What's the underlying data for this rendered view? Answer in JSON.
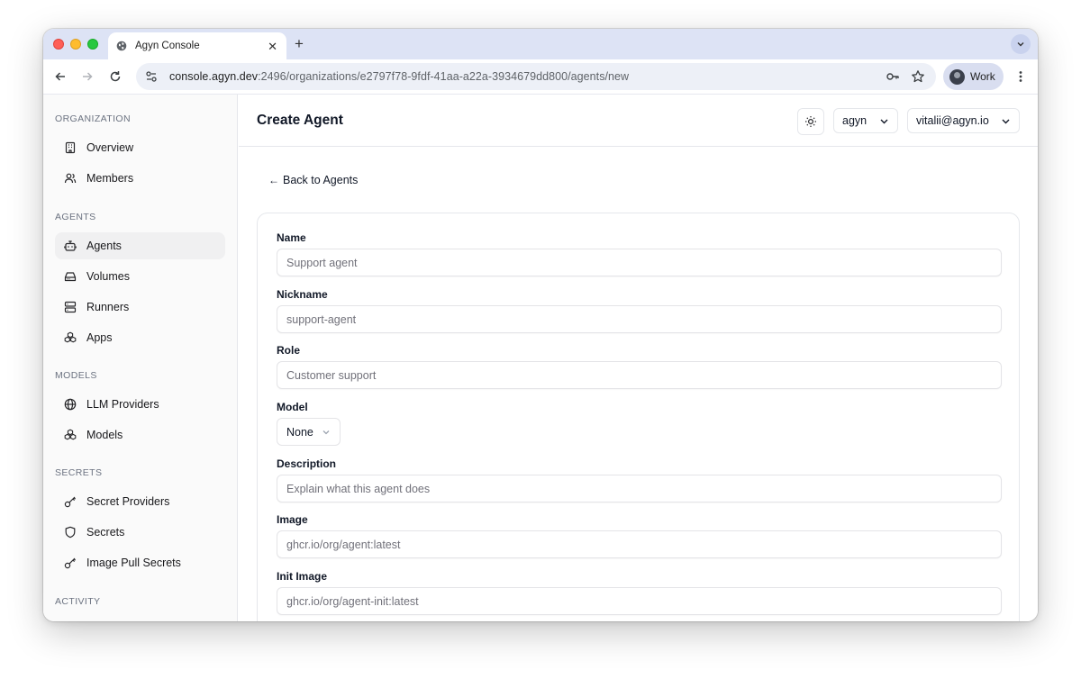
{
  "browser": {
    "tab_title": "Agyn Console",
    "new_tab_glyph": "+",
    "url_host": "console.agyn.dev",
    "url_path": ":2496/organizations/e2797f78-9fdf-41aa-a22a-3934679dd800/agents/new",
    "profile_label": "Work"
  },
  "sidebar": {
    "sections": [
      {
        "label": "ORGANIZATION",
        "items": [
          {
            "label": "Overview",
            "icon": "building-icon"
          },
          {
            "label": "Members",
            "icon": "users-icon"
          }
        ]
      },
      {
        "label": "AGENTS",
        "items": [
          {
            "label": "Agents",
            "icon": "bot-icon",
            "active": true
          },
          {
            "label": "Volumes",
            "icon": "hard-drive-icon"
          },
          {
            "label": "Runners",
            "icon": "server-icon"
          },
          {
            "label": "Apps",
            "icon": "boxes-icon"
          }
        ]
      },
      {
        "label": "MODELS",
        "items": [
          {
            "label": "LLM Providers",
            "icon": "globe-icon"
          },
          {
            "label": "Models",
            "icon": "boxes-icon"
          }
        ]
      },
      {
        "label": "SECRETS",
        "items": [
          {
            "label": "Secret Providers",
            "icon": "key-icon"
          },
          {
            "label": "Secrets",
            "icon": "shield-icon"
          },
          {
            "label": "Image Pull Secrets",
            "icon": "key-icon"
          }
        ]
      },
      {
        "label": "ACTIVITY",
        "items": []
      }
    ]
  },
  "header": {
    "title": "Create Agent",
    "org_select": "agyn",
    "user_select": "vitalii@agyn.io"
  },
  "back_link": "Back to Agents",
  "form": {
    "name": {
      "label": "Name",
      "placeholder": "Support agent",
      "value": ""
    },
    "nickname": {
      "label": "Nickname",
      "placeholder": "support-agent",
      "value": ""
    },
    "role": {
      "label": "Role",
      "placeholder": "Customer support",
      "value": ""
    },
    "model": {
      "label": "Model",
      "selected": "None"
    },
    "description": {
      "label": "Description",
      "placeholder": "Explain what this agent does",
      "value": ""
    },
    "image": {
      "label": "Image",
      "placeholder": "ghcr.io/org/agent:latest",
      "value": ""
    },
    "init_image": {
      "label": "Init Image",
      "placeholder": "ghcr.io/org/agent-init:latest",
      "value": ""
    }
  }
}
